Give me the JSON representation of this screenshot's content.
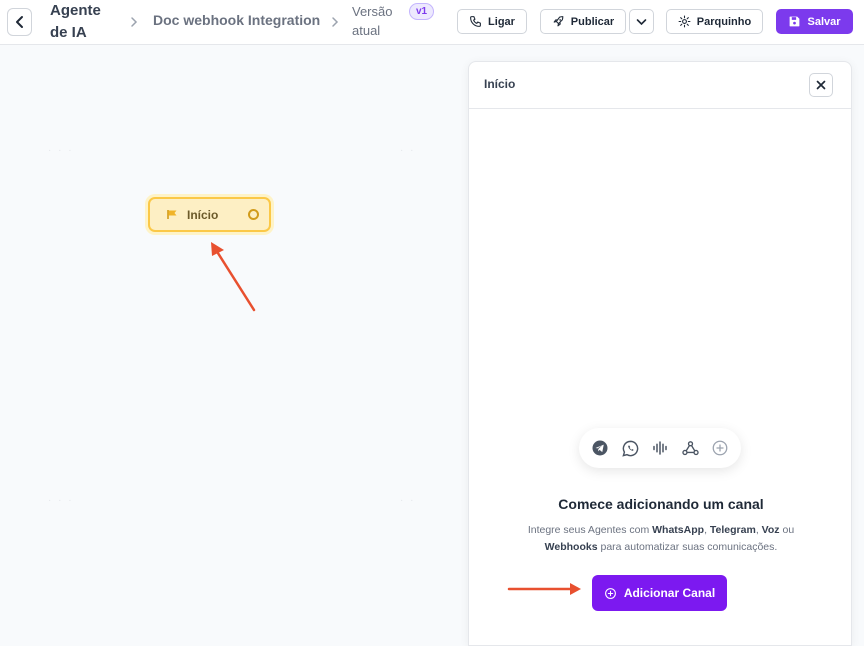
{
  "header": {
    "breadcrumb_agent": "Agente de IA",
    "breadcrumb_doc": "Doc webhook Integration",
    "breadcrumb_version": "Versão atual",
    "version_badge": "v1",
    "buttons": {
      "ligar": "Ligar",
      "publicar": "Publicar",
      "parquinho": "Parquinho",
      "salvar": "Salvar"
    }
  },
  "canvas": {
    "start_node_label": "Início"
  },
  "panel": {
    "title": "Início",
    "channel_icons": [
      "telegram-icon",
      "whatsapp-icon",
      "voice-icon",
      "webhook-icon",
      "add-circle-icon"
    ],
    "empty_title": "Comece adicionando um canal",
    "empty_desc_prefix": "Integre seus Agentes com ",
    "empty_desc_whatsapp": "WhatsApp",
    "empty_desc_sep1": ", ",
    "empty_desc_telegram": "Telegram",
    "empty_desc_sep2": ", ",
    "empty_desc_voz": "Voz",
    "empty_desc_ou": " ou ",
    "empty_desc_webhooks": "Webhooks",
    "empty_desc_suffix": " para automatizar suas comunicações.",
    "add_channel_label": "Adicionar Canal"
  },
  "colors": {
    "accent": "#7c3aed",
    "add_channel_bg": "#7c19f0",
    "node_bg": "#fdefc4",
    "node_border": "#fbc847",
    "annotation_arrow": "#e8502f"
  }
}
